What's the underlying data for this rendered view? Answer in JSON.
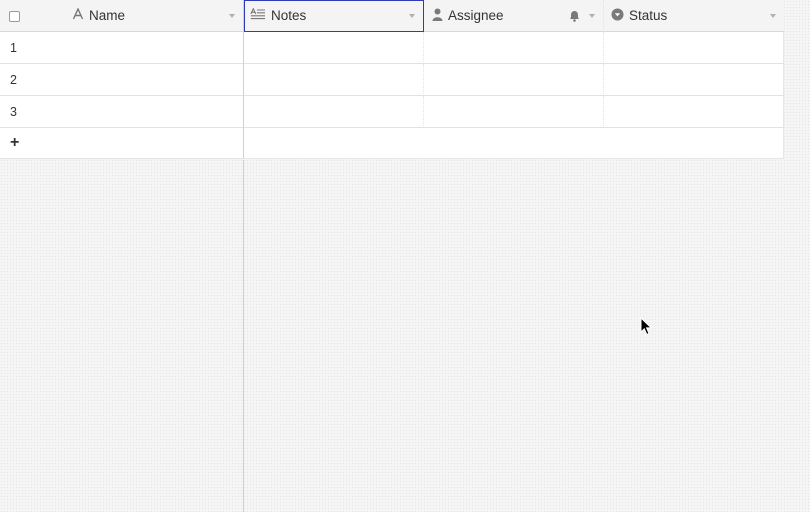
{
  "columns": {
    "name": {
      "label": "Name",
      "icon": "text-field-icon"
    },
    "notes": {
      "label": "Notes",
      "icon": "long-text-field-icon"
    },
    "assignee": {
      "label": "Assignee",
      "icon": "user-field-icon"
    },
    "status": {
      "label": "Status",
      "icon": "single-select-field-icon"
    }
  },
  "rows": [
    {
      "number": "1"
    },
    {
      "number": "2"
    },
    {
      "number": "3"
    }
  ],
  "add_row_label": "+",
  "colors": {
    "selection_outline": "#2d3bb5",
    "header_bg": "#f4f4f4"
  }
}
